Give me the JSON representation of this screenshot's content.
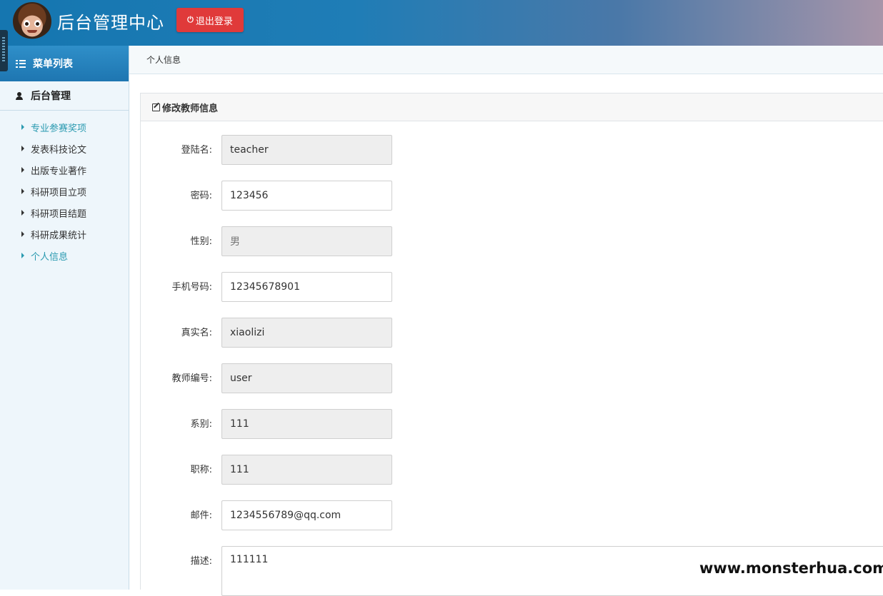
{
  "header": {
    "title": "后台管理中心",
    "logout_label": "退出登录",
    "logout_icon": "power-icon",
    "gradient": [
      "#1576b0",
      "#a795a9"
    ]
  },
  "sidebar": {
    "menu_title": "菜单列表",
    "group_title": "后台管理",
    "items": [
      {
        "label": "专业参赛奖项",
        "active": true
      },
      {
        "label": "发表科技论文",
        "active": false
      },
      {
        "label": "出版专业著作",
        "active": false
      },
      {
        "label": "科研项目立项",
        "active": false
      },
      {
        "label": "科研项目结题",
        "active": false
      },
      {
        "label": "科研成果统计",
        "active": false
      },
      {
        "label": "个人信息",
        "active": true
      }
    ]
  },
  "breadcrumb": "个人信息",
  "panel": {
    "title": "修改教师信息",
    "fields": [
      {
        "label": "登陆名:",
        "value": "teacher",
        "readonly": true
      },
      {
        "label": "密码:",
        "value": "123456",
        "readonly": false
      },
      {
        "label": "性别:",
        "value": "男",
        "readonly": true
      },
      {
        "label": "手机号码:",
        "value": "12345678901",
        "readonly": false
      },
      {
        "label": "真实名:",
        "value": "xiaolizi",
        "readonly": true
      },
      {
        "label": "教师编号:",
        "value": "user",
        "readonly": true
      },
      {
        "label": "系别:",
        "value": "111",
        "readonly": true
      },
      {
        "label": "职称:",
        "value": "111",
        "readonly": true
      },
      {
        "label": "邮件:",
        "value": "1234556789@qq.com",
        "readonly": false
      },
      {
        "label": "描述:",
        "value": "111111",
        "readonly": false
      }
    ]
  },
  "watermark": "www.monsterhua.com",
  "colors": {
    "active_link": "#2a9ab0",
    "logout": "#e03a3a",
    "sidebar_bg": "#eef6fb"
  }
}
